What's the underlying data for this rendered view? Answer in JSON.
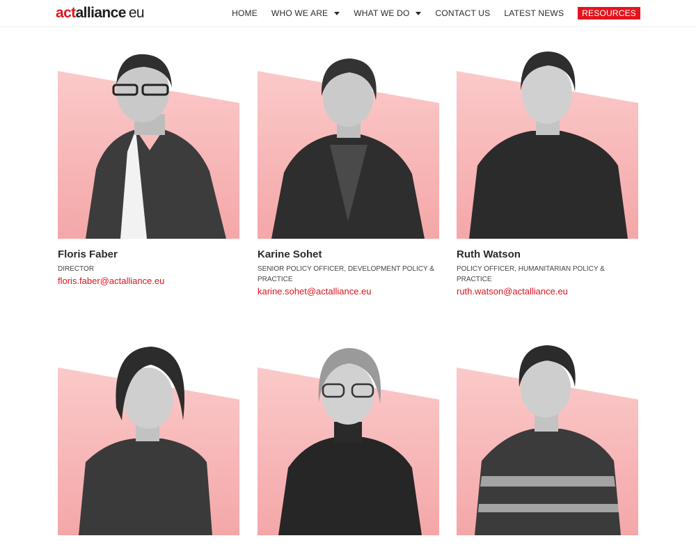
{
  "header": {
    "logo": {
      "act": "act",
      "alliance": "alliance",
      "eu": "eu"
    },
    "nav": [
      {
        "label": "HOME",
        "dropdown": false
      },
      {
        "label": "WHO WE ARE",
        "dropdown": true
      },
      {
        "label": "WHAT WE DO",
        "dropdown": true
      },
      {
        "label": "CONTACT US",
        "dropdown": false
      },
      {
        "label": "LATEST NEWS",
        "dropdown": false
      },
      {
        "label": "RESOURCES",
        "dropdown": false,
        "highlight": true
      }
    ]
  },
  "team": [
    {
      "name": "Floris Faber",
      "role": "DIRECTOR",
      "email": "floris.faber@actalliance.eu"
    },
    {
      "name": "Karine Sohet",
      "role": "SENIOR POLICY OFFICER, DEVELOPMENT POLICY & PRACTICE",
      "email": "karine.sohet@actalliance.eu"
    },
    {
      "name": "Ruth Watson",
      "role": "POLICY OFFICER, HUMANITARIAN POLICY & PRACTICE",
      "email": "ruth.watson@actalliance.eu"
    },
    {
      "name": "",
      "role": "",
      "email": ""
    },
    {
      "name": "",
      "role": "",
      "email": ""
    },
    {
      "name": "",
      "role": "",
      "email": ""
    }
  ],
  "colors": {
    "accent": "#e3141e",
    "photo_bg": "#f6b7b8",
    "text": "#2b2b2b"
  }
}
